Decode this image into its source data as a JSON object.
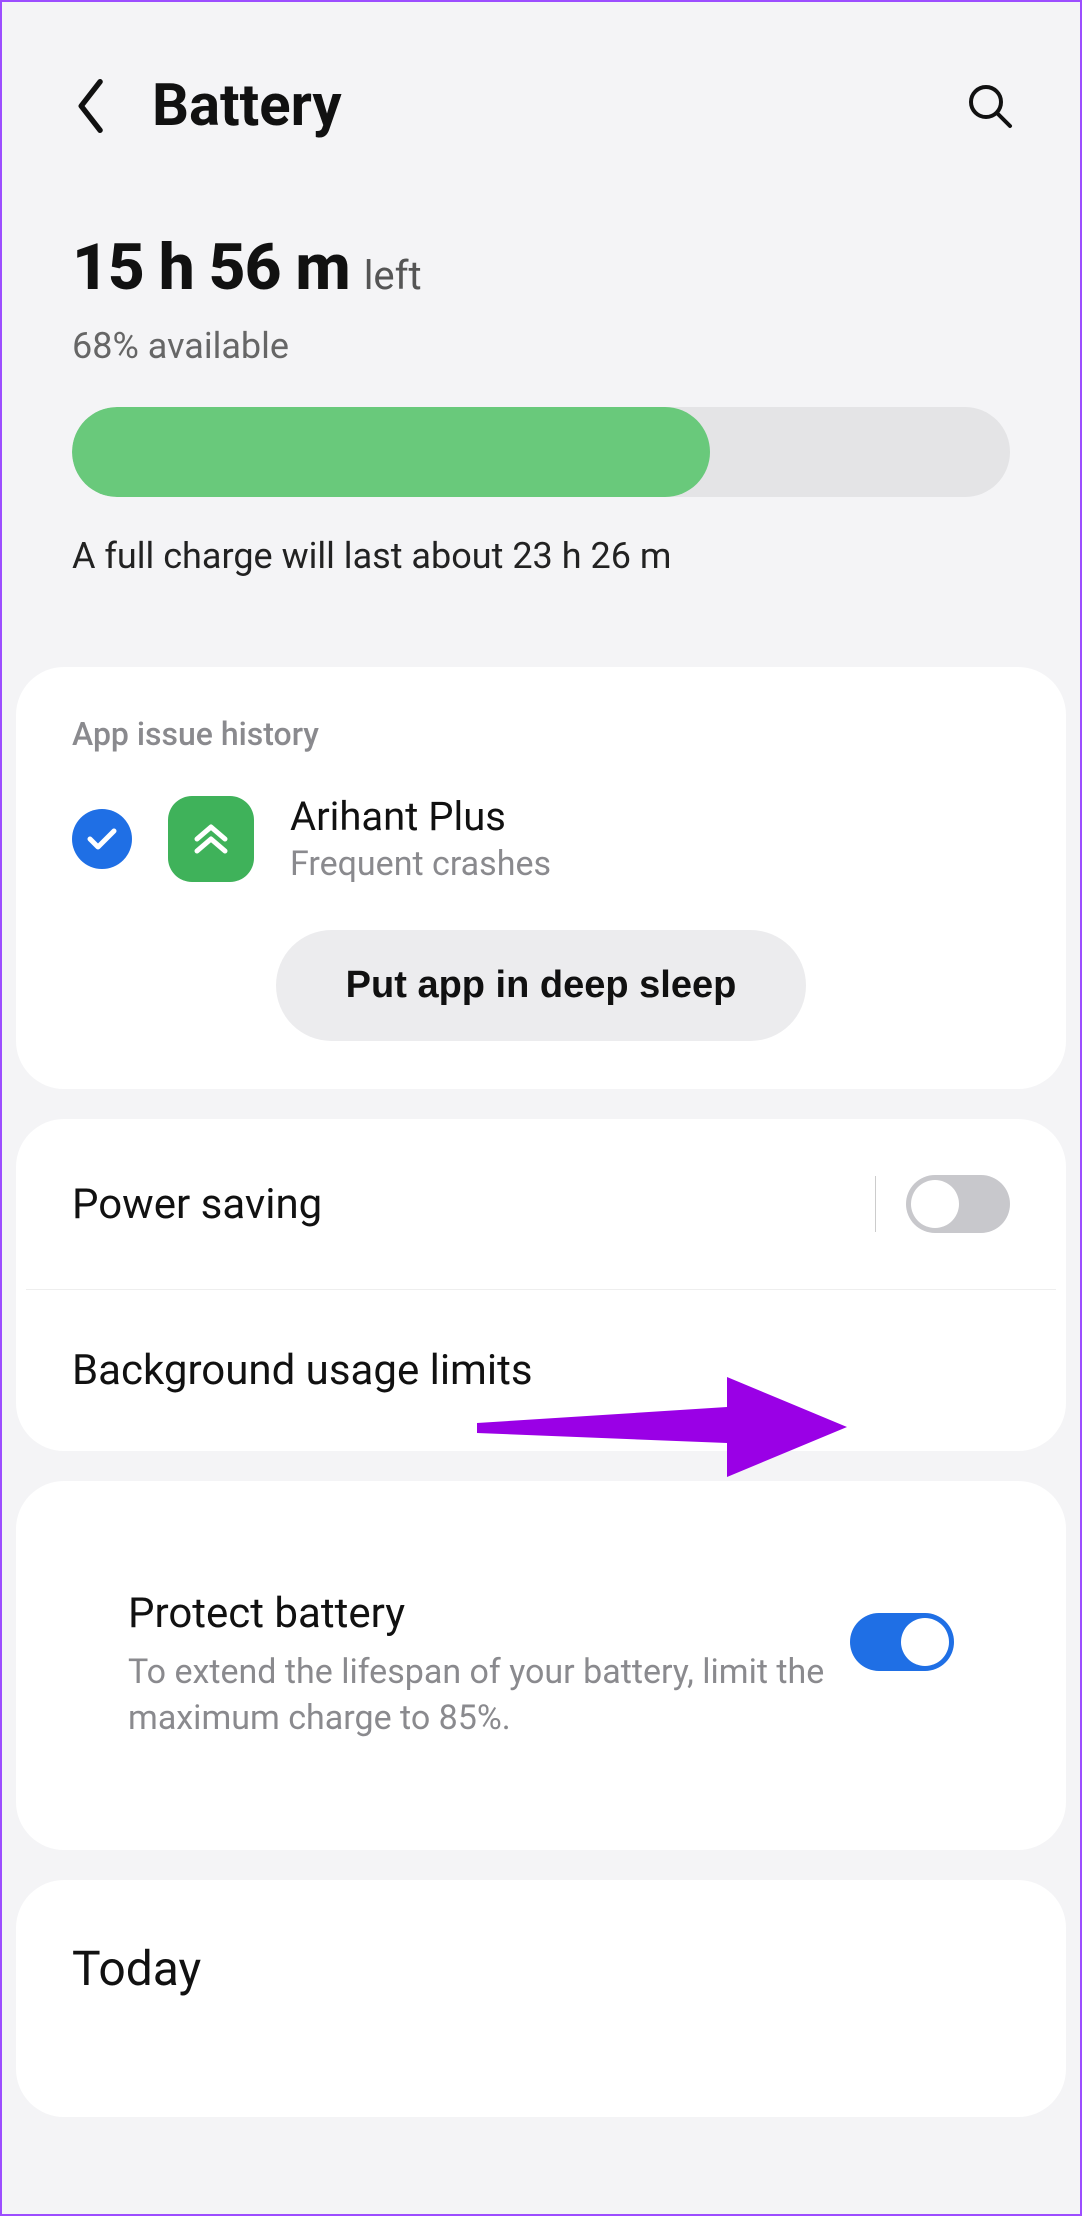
{
  "header": {
    "title": "Battery"
  },
  "summary": {
    "time_value": "15 h 56 m",
    "time_suffix": "left",
    "available": "68% available",
    "percent": 68,
    "full_charge": "A full charge will last about 23 h 26 m"
  },
  "app_issue": {
    "section_title": "App issue history",
    "app_name": "Arihant Plus",
    "app_issue": "Frequent crashes",
    "action_label": "Put app in deep sleep"
  },
  "settings": {
    "power_saving": {
      "label": "Power saving",
      "on": false
    },
    "bg_limits": {
      "label": "Background usage limits"
    },
    "protect": {
      "title": "Protect battery",
      "subtitle": "To extend the lifespan of your battery, limit the maximum charge to 85%.",
      "on": true
    }
  },
  "today": {
    "title": "Today"
  },
  "annotation": {
    "color": "#9a00e6"
  }
}
